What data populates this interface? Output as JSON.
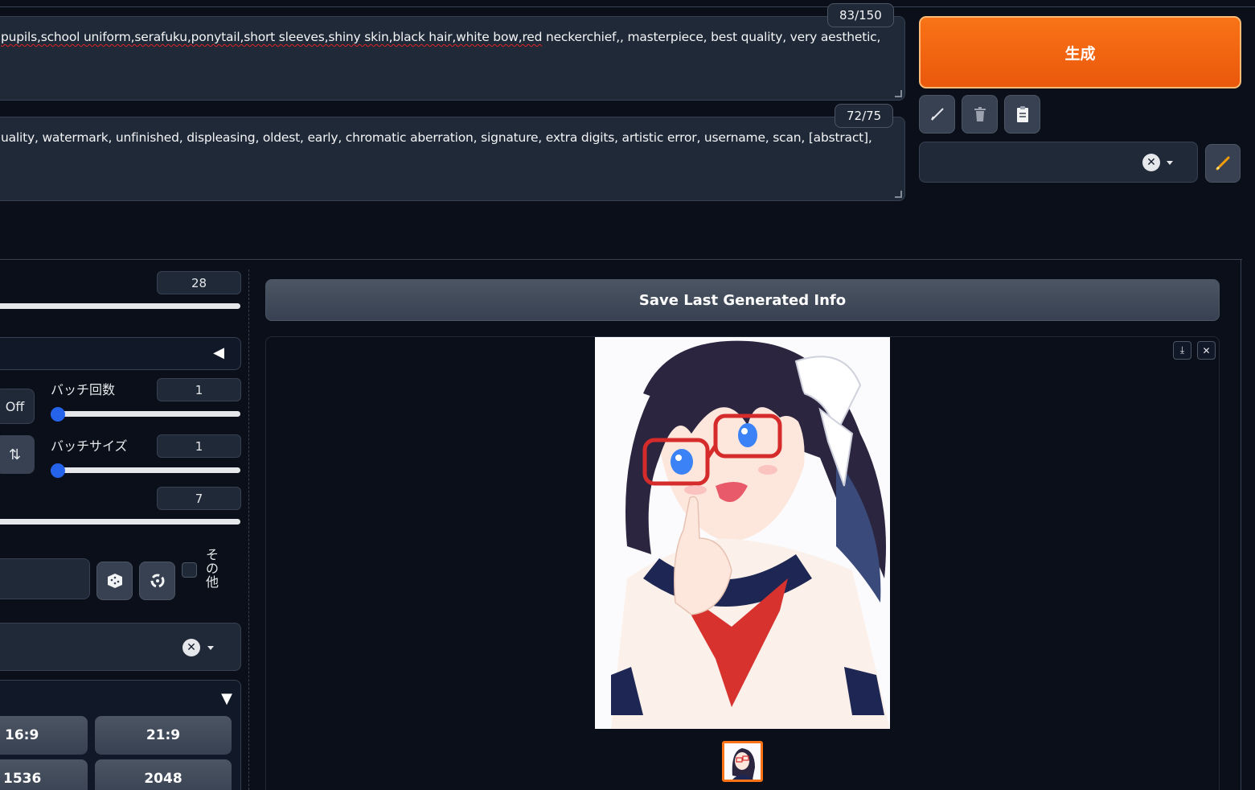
{
  "prompt": {
    "text_wavy": "pupils,school uniform,serafuku,ponytail,short sleeves,shiny skin,black hair,white bow,red",
    "text_plain": " neckerchief,, masterpiece, best quality, very aesthetic,",
    "counter": "83/150"
  },
  "negative_prompt": {
    "text": "uality, watermark, unfinished, displeasing, oldest, early, chromatic aberration, signature, extra digits, artistic error, username, scan, [abstract],",
    "counter": "72/75"
  },
  "generate_button": {
    "label": "生成"
  },
  "toolbar": {
    "icons": [
      "pencil-slash-icon",
      "trash-icon",
      "clipboard-icon"
    ]
  },
  "style_select": {
    "clear_symbol": "✕"
  },
  "settings": {
    "steps_value": "28",
    "batch_count_label": "バッチ回数",
    "batch_count_value": "1",
    "batch_size_label": "バッチサイズ",
    "batch_size_value": "1",
    "cfg_value": "7",
    "off_label": "Off",
    "swap_symbol": "⇅",
    "other_label": "その他",
    "collapse_symbol": "◀",
    "expand_symbol": "▼"
  },
  "ratio_buttons": [
    {
      "label": "16:9"
    },
    {
      "label": "21:9"
    },
    {
      "label": "1536"
    },
    {
      "label": "2048"
    }
  ],
  "save_info_button": {
    "label": "Save Last Generated Info"
  },
  "gallery": {
    "download_symbol": "⤓",
    "close_symbol": "✕"
  }
}
